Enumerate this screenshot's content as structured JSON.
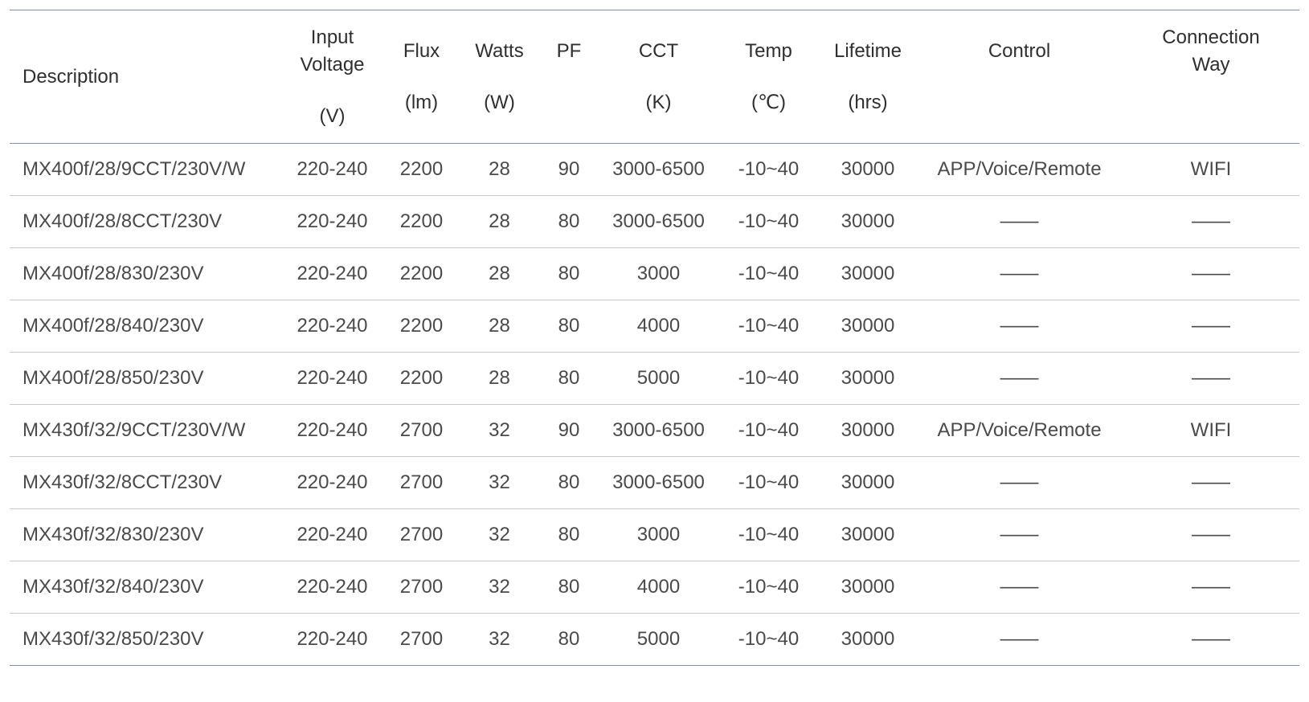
{
  "table": {
    "columns": [
      {
        "key": "description",
        "title": [
          "Description"
        ],
        "unit": ""
      },
      {
        "key": "input_voltage",
        "title": [
          "Input",
          "Voltage"
        ],
        "unit": "(V)"
      },
      {
        "key": "flux",
        "title": [
          "Flux"
        ],
        "unit": "(lm)"
      },
      {
        "key": "watts",
        "title": [
          "Watts"
        ],
        "unit": "(W)"
      },
      {
        "key": "pf",
        "title": [
          "PF"
        ],
        "unit": ""
      },
      {
        "key": "cct",
        "title": [
          "CCT"
        ],
        "unit": "(K)"
      },
      {
        "key": "temp",
        "title": [
          "Temp"
        ],
        "unit": "(℃)"
      },
      {
        "key": "lifetime",
        "title": [
          "Lifetime"
        ],
        "unit": "(hrs)"
      },
      {
        "key": "control",
        "title": [
          "Control"
        ],
        "unit": ""
      },
      {
        "key": "connection_way",
        "title": [
          "Connection",
          "Way"
        ],
        "unit": ""
      }
    ],
    "rows": [
      [
        "MX400f/28/9CCT/230V/W",
        "220-240",
        "2200",
        "28",
        "90",
        "3000-6500",
        "-10~40",
        "30000",
        "APP/Voice/Remote",
        "WIFI"
      ],
      [
        "MX400f/28/8CCT/230V",
        "220-240",
        "2200",
        "28",
        "80",
        "3000-6500",
        "-10~40",
        "30000",
        "——",
        "——"
      ],
      [
        "MX400f/28/830/230V",
        "220-240",
        "2200",
        "28",
        "80",
        "3000",
        "-10~40",
        "30000",
        "——",
        "——"
      ],
      [
        "MX400f/28/840/230V",
        "220-240",
        "2200",
        "28",
        "80",
        "4000",
        "-10~40",
        "30000",
        "——",
        "——"
      ],
      [
        "MX400f/28/850/230V",
        "220-240",
        "2200",
        "28",
        "80",
        "5000",
        "-10~40",
        "30000",
        "——",
        "——"
      ],
      [
        "MX430f/32/9CCT/230V/W",
        "220-240",
        "2700",
        "32",
        "90",
        "3000-6500",
        "-10~40",
        "30000",
        "APP/Voice/Remote",
        "WIFI"
      ],
      [
        "MX430f/32/8CCT/230V",
        "220-240",
        "2700",
        "32",
        "80",
        "3000-6500",
        "-10~40",
        "30000",
        "——",
        "——"
      ],
      [
        "MX430f/32/830/230V",
        "220-240",
        "2700",
        "32",
        "80",
        "3000",
        "-10~40",
        "30000",
        "——",
        "——"
      ],
      [
        "MX430f/32/840/230V",
        "220-240",
        "2700",
        "32",
        "80",
        "4000",
        "-10~40",
        "30000",
        "——",
        "——"
      ],
      [
        "MX430f/32/850/230V",
        "220-240",
        "2700",
        "32",
        "80",
        "5000",
        "-10~40",
        "30000",
        "——",
        "——"
      ]
    ]
  },
  "colors": {
    "rule_accent": "#7f93b4",
    "row_divider": "#c8c8c8",
    "text": "#404040"
  }
}
